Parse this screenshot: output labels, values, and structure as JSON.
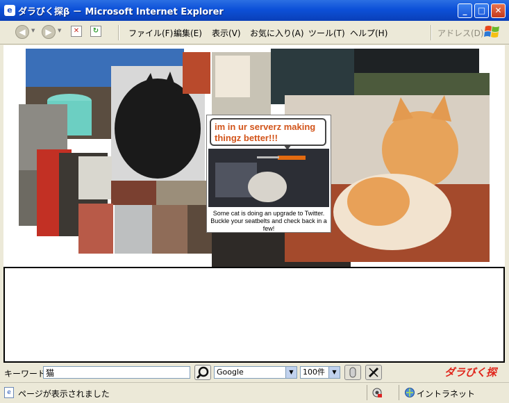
{
  "window": {
    "title": "ダラびく探β － Microsoft Internet Explorer",
    "minimize_label": "_",
    "maximize_label": "□",
    "close_label": "✕"
  },
  "menu": {
    "items": [
      "ファイル(F)",
      "編集(E)",
      "表示(V)",
      "お気に入り(A)",
      "ツール(T)",
      "ヘルプ(H)"
    ],
    "address_label": "アドレス(D)"
  },
  "fail_page": {
    "bubble_text": "im in ur serverz making thingz better!!!",
    "caption": "Some cat is doing an upgrade to Twitter. Buckle your seatbelts and check back in a few!"
  },
  "search": {
    "keyword_label": "キーワード",
    "keyword_value": "猫",
    "engine_selected": "Google",
    "count_selected": "100件",
    "brand_text": "ダラびく探"
  },
  "status": {
    "message": "ページが表示されました",
    "zone": "イントラネット"
  },
  "colors": {
    "titlebar": "#0c50d8",
    "bubble_text": "#d2541a",
    "brand": "#e0241a"
  }
}
